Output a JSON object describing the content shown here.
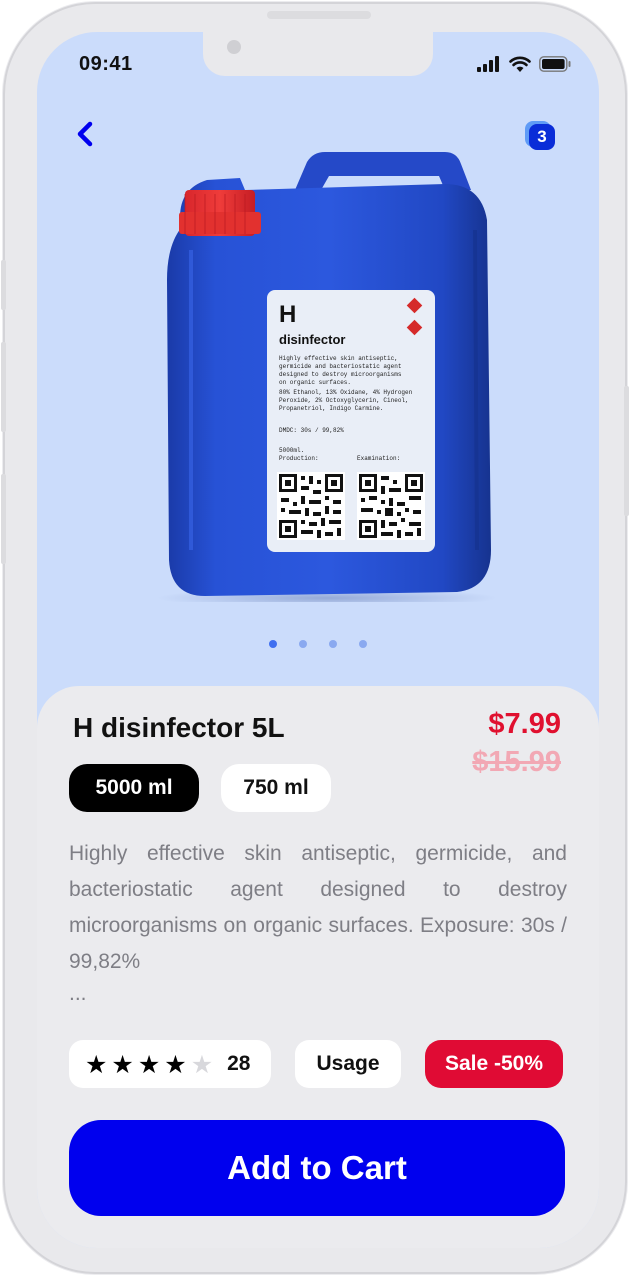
{
  "status_bar": {
    "time": "09:41",
    "icons": [
      "signal-icon",
      "wifi-icon",
      "battery-icon"
    ]
  },
  "header": {
    "back_icon": "chevron-left-icon",
    "cart_icon": "cart-icon",
    "cart_count": "3"
  },
  "product_image": {
    "label_letter": "H",
    "label_name": "disinfector",
    "label_description": [
      "Highly effective skin antiseptic,",
      "germicide and bacteriostatic agent",
      "designed to destroy microorganisms",
      "on organic surfaces.",
      "80% Ethanol, 13% Oxidane, 4% Hydrogen",
      "Peroxide, 2% Octoxyglycerin, Cineol,",
      "Propanetriol, Indigo Carmine."
    ],
    "label_dmdc": "DMDC: 30s / 99,82%",
    "label_volume": "5000ml.",
    "label_production": "Production:",
    "label_examination": "Examination:"
  },
  "carousel": {
    "count": 4,
    "active_index": 0
  },
  "product": {
    "title": "H disinfector 5L",
    "price": "$7.99",
    "old_price": "$15.99",
    "sizes": [
      {
        "label": "5000 ml",
        "selected": true
      },
      {
        "label": "750 ml",
        "selected": false
      }
    ],
    "description": "Highly effective skin antiseptic, germicide, and bacteriostatic agent designed to destroy microorganisms on organic surfaces. Exposure: 30s / 99,82%",
    "description_more": "...",
    "rating": {
      "value": 4,
      "max": 5,
      "count": "28"
    },
    "usage_label": "Usage",
    "sale_label": "Sale -50%"
  },
  "add_to_cart_label": "Add to Cart",
  "colors": {
    "accent": "#0000ee",
    "price": "#e0102f",
    "old_price": "#f2a8b4",
    "sale": "#e00b34",
    "background": "#cbdcfb"
  }
}
